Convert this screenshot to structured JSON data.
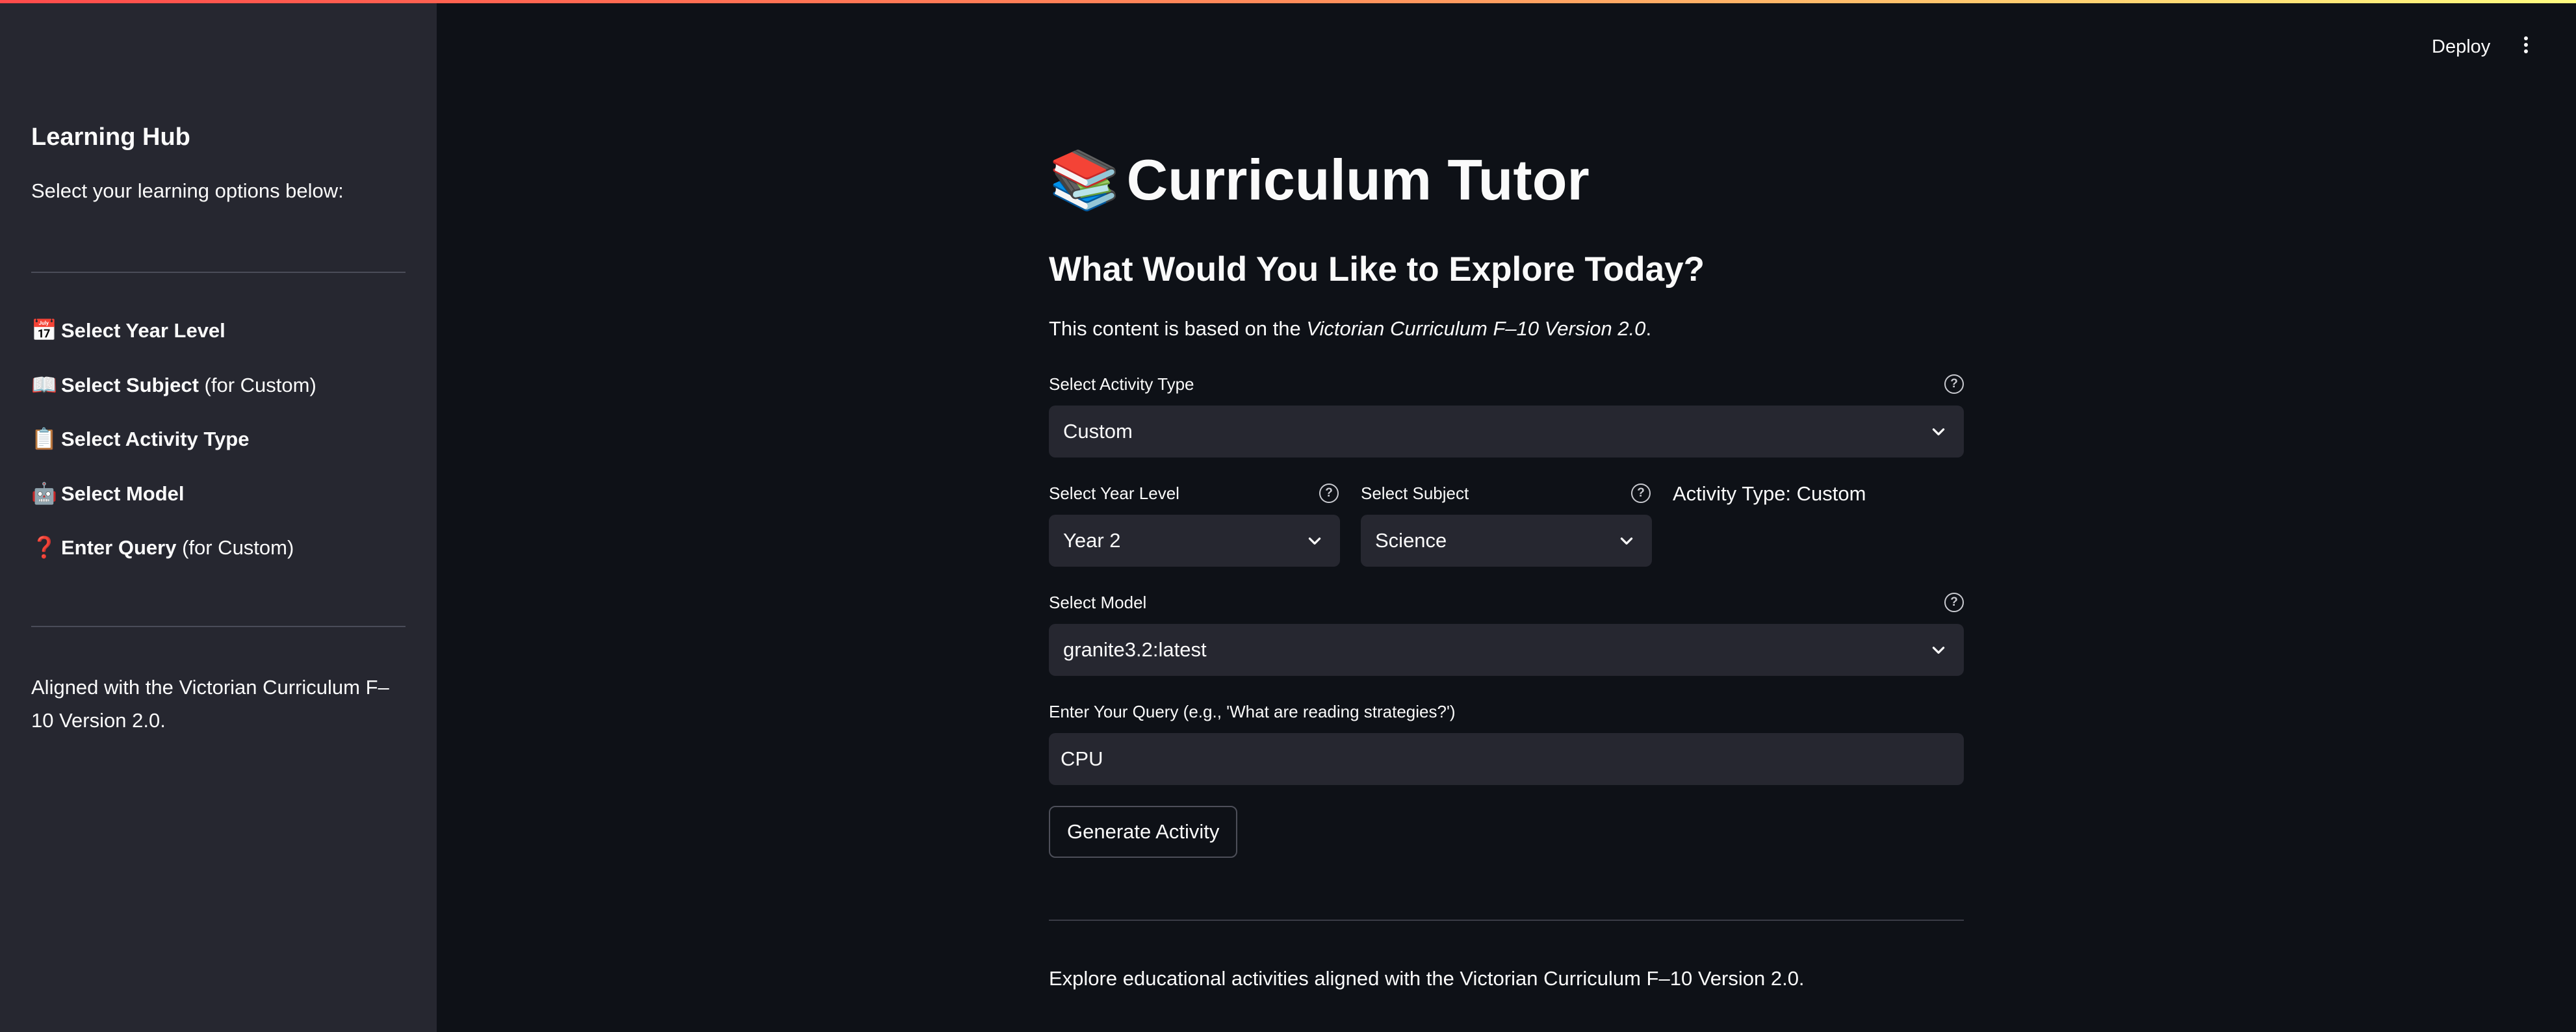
{
  "sidebar": {
    "title": "Learning Hub",
    "subtitle": "Select your learning options below:",
    "steps": [
      {
        "emoji": "📅",
        "label": "Select Year Level",
        "suffix": ""
      },
      {
        "emoji": "📖",
        "label": "Select Subject",
        "suffix": " (for Custom)"
      },
      {
        "emoji": "📋",
        "label": "Select Activity Type",
        "suffix": ""
      },
      {
        "emoji": "🤖",
        "label": "Select Model",
        "suffix": ""
      },
      {
        "emoji": "❓",
        "label": "Enter Query",
        "suffix": " (for Custom)"
      }
    ],
    "footer": "Aligned with the Victorian Curriculum F–10 Version 2.0."
  },
  "header": {
    "deploy_label": "Deploy",
    "menu_icon": "kebab-menu-icon"
  },
  "main": {
    "title_emoji": "📚",
    "title": "Curriculum Tutor",
    "section_title": "What Would You Like to Explore Today?",
    "intro_prefix": "This content is based on the ",
    "intro_italic": "Victorian Curriculum F–10 Version 2.0",
    "intro_suffix": ".",
    "activity_type": {
      "label": "Select Activity Type",
      "value": "Custom"
    },
    "year_level": {
      "label": "Select Year Level",
      "value": "Year 2"
    },
    "subject": {
      "label": "Select Subject",
      "value": "Science"
    },
    "activity_type_display": "Activity Type: Custom",
    "model": {
      "label": "Select Model",
      "value": "granite3.2:latest"
    },
    "query": {
      "label": "Enter Your Query (e.g., 'What are reading strategies?')",
      "value": "CPU"
    },
    "generate_label": "Generate Activity",
    "footer_text": "Explore educational activities aligned with the Victorian Curriculum F–10 Version 2.0."
  },
  "colors": {
    "background": "#0e1117",
    "sidebar": "#262730",
    "input": "#262730",
    "text": "#fafafa",
    "accent_gradient_start": "#ff4b4b",
    "accent_gradient_end": "#fffd80"
  }
}
